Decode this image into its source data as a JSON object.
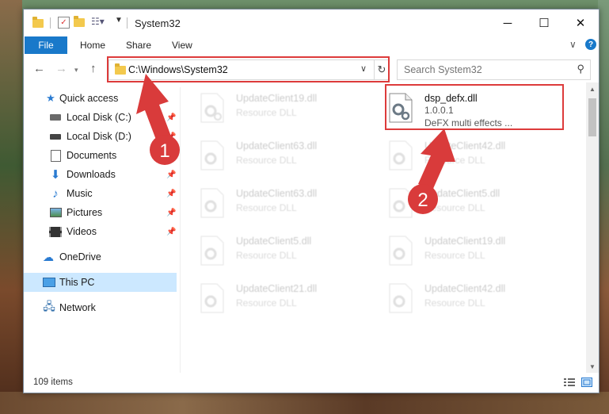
{
  "window": {
    "title": "System32"
  },
  "colors": {
    "accent": "#1979ca",
    "highlight": "#dd3b3b",
    "selection": "#cce8ff"
  },
  "ribbon": {
    "tabs": [
      "File",
      "Home",
      "Share",
      "View"
    ]
  },
  "address": {
    "path": "C:\\Windows\\System32"
  },
  "search": {
    "placeholder": "Search System32"
  },
  "sidebar": {
    "items": [
      {
        "label": "Quick access",
        "icon": "star-icon"
      },
      {
        "label": "Local Disk (C:)",
        "icon": "drive-icon",
        "pinned": true
      },
      {
        "label": "Local Disk (D:)",
        "icon": "drive-icon",
        "pinned": true
      },
      {
        "label": "Documents",
        "icon": "documents-icon",
        "pinned": true
      },
      {
        "label": "Downloads",
        "icon": "download-icon",
        "pinned": true
      },
      {
        "label": "Music",
        "icon": "music-icon",
        "pinned": true
      },
      {
        "label": "Pictures",
        "icon": "pictures-icon",
        "pinned": true
      },
      {
        "label": "Videos",
        "icon": "videos-icon",
        "pinned": true
      },
      {
        "label": "OneDrive",
        "icon": "cloud-icon"
      },
      {
        "label": "This PC",
        "icon": "computer-icon",
        "selected": true
      },
      {
        "label": "Network",
        "icon": "network-icon"
      }
    ]
  },
  "files": [
    {
      "name": "UpdateClient19.dll",
      "description": "Resource DLL",
      "faded": true
    },
    {
      "name": "dsp_defx.dll",
      "version": "1.0.0.1",
      "description": "DeFX multi effects ...",
      "faded": false,
      "highlighted": true
    },
    {
      "name": "UpdateClient63.dll",
      "description": "Resource DLL",
      "faded": true
    },
    {
      "name": "UpdateClient42.dll",
      "description": "Resource DLL",
      "faded": true
    },
    {
      "name": "UpdateClient63.dll",
      "description": "Resource DLL",
      "faded": true
    },
    {
      "name": "UpdateClient5.dll",
      "description": "Resource DLL",
      "faded": true
    },
    {
      "name": "UpdateClient5.dll",
      "description": "Resource DLL",
      "faded": true
    },
    {
      "name": "UpdateClient19.dll",
      "description": "Resource DLL",
      "faded": true
    },
    {
      "name": "UpdateClient21.dll",
      "description": "Resource DLL",
      "faded": true
    },
    {
      "name": "UpdateClient42.dll",
      "description": "Resource DLL",
      "faded": true
    }
  ],
  "status": {
    "item_count": "109 items"
  },
  "annotations": {
    "step1": "1",
    "step2": "2"
  }
}
